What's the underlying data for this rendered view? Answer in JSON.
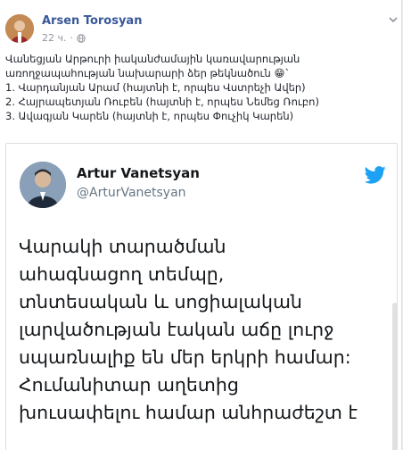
{
  "post": {
    "author": "Arsen Torosyan",
    "time": "22 ч.",
    "text_lines": [
      "Վանեցյան Արթուրի իականժամային կառավարության",
      "առողջապահության նախարարի ձեր թեկնածուն 😁`",
      "1. Վարդանյան Արամ (հայտնի է, որպես Վստրեչի Ավեր)",
      "2. Հայրապետյան Ռուբեն (հայտնի է, որպես Նեմեց Ռուբո)",
      "3. Ավագյան Կարեն (հայտնի է, որպես Փուչիկ Կարեն)"
    ]
  },
  "tweet": {
    "name": "Artur Vanetsyan",
    "handle": "@ArturVanetsyan",
    "body_lines": [
      "Վարակի տարածման",
      "ահագնացող տեմպը,",
      "տնտեսական և սոցիալական",
      "լարվածության էական աճը լուրջ",
      "սպառնալիք են մեր երկրի համար:",
      "Հումանիտար աղետից",
      "խուսափելու համար անհրաժեշտ է"
    ]
  },
  "icons": {
    "globe": "globe-icon",
    "chevron": "chevron-down-icon",
    "twitter": "twitter-bird-icon"
  },
  "colors": {
    "author_link": "#385898",
    "twitter_blue": "#1da1f2"
  }
}
